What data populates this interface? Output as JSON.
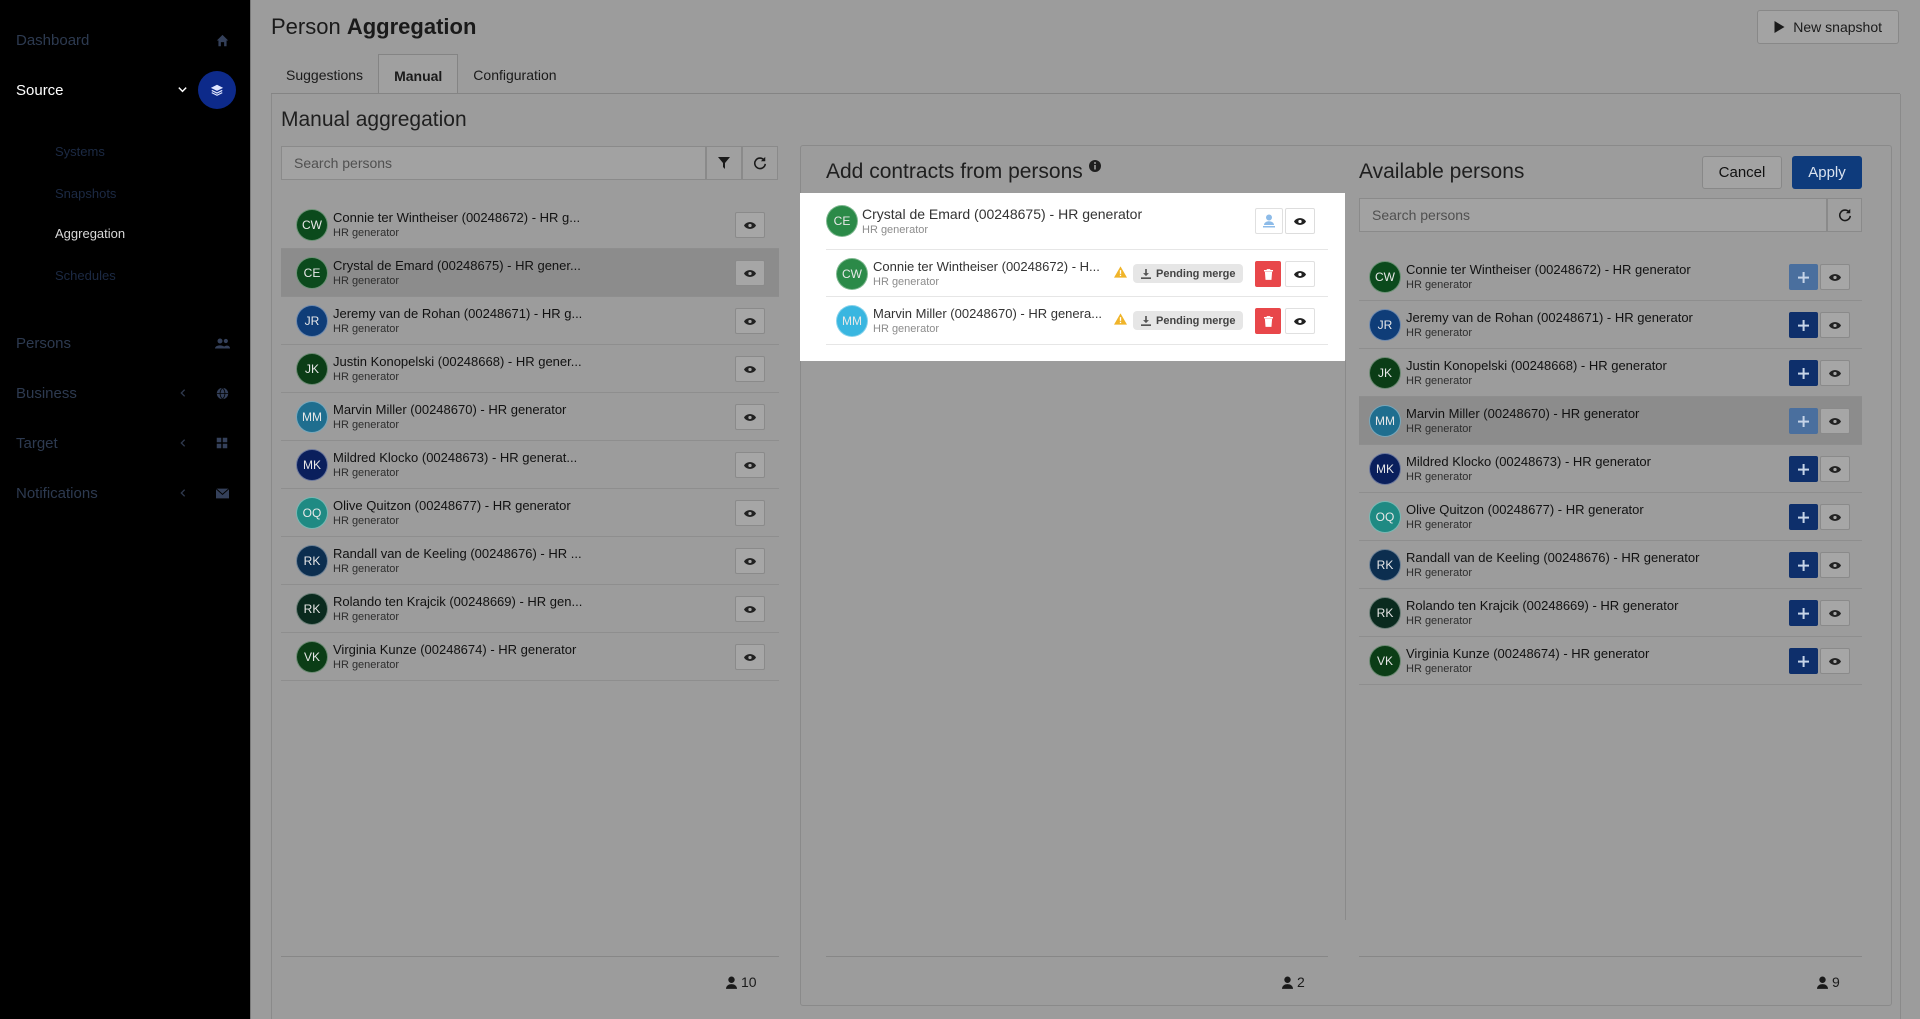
{
  "sidebar": {
    "items": [
      {
        "label": "Dashboard",
        "icon": "home-icon"
      },
      {
        "label": "Source",
        "icon": "layers-icon"
      },
      {
        "label": "Persons",
        "icon": "users-icon"
      },
      {
        "label": "Business",
        "icon": "globe-icon"
      },
      {
        "label": "Target",
        "icon": "grid-icon"
      },
      {
        "label": "Notifications",
        "icon": "envelope-icon"
      }
    ],
    "source_sub": [
      "Systems",
      "Snapshots",
      "Aggregation",
      "Schedules"
    ]
  },
  "header": {
    "title_light": "Person ",
    "title_bold": "Aggregation",
    "snapshot_label": "New snapshot"
  },
  "tabs": [
    "Suggestions",
    "Manual",
    "Configuration"
  ],
  "manual": {
    "title": "Manual aggregation",
    "search_placeholder": "Search persons",
    "persons": [
      {
        "initials": "CW",
        "name": "Connie ter Wintheiser (00248672) - HR g...",
        "sub": "HR generator",
        "color": "#0b4a1c"
      },
      {
        "initials": "CE",
        "name": "Crystal de Emard (00248675) - HR gener...",
        "sub": "HR generator",
        "color": "#0b4a1c"
      },
      {
        "initials": "JR",
        "name": "Jeremy van de Rohan (00248671) - HR g...",
        "sub": "HR generator",
        "color": "#0f3d78"
      },
      {
        "initials": "JK",
        "name": "Justin Konopelski (00248668) - HR gener...",
        "sub": "HR generator",
        "color": "#0b3d16"
      },
      {
        "initials": "MM",
        "name": "Marvin Miller (00248670) - HR generator",
        "sub": "HR generator",
        "color": "#1f6e8f"
      },
      {
        "initials": "MK",
        "name": "Mildred Klocko (00248673) - HR generat...",
        "sub": "HR generator",
        "color": "#0a1f5c"
      },
      {
        "initials": "OQ",
        "name": "Olive Quitzon (00248677) - HR generator",
        "sub": "HR generator",
        "color": "#1f8a83"
      },
      {
        "initials": "RK",
        "name": "Randall van de Keeling (00248676) - HR ...",
        "sub": "HR generator",
        "color": "#0c2e4f"
      },
      {
        "initials": "RK",
        "name": "Rolando ten Krajcik (00248669) - HR gen...",
        "sub": "HR generator",
        "color": "#0a2a1e"
      },
      {
        "initials": "VK",
        "name": "Virginia Kunze (00248674) - HR generator",
        "sub": "HR generator",
        "color": "#0b3d16"
      }
    ],
    "count": "10"
  },
  "contracts": {
    "title": "Add contracts from persons",
    "primary": {
      "initials": "CE",
      "name": "Crystal de Emard (00248675) - HR generator",
      "sub": "HR generator",
      "color": "#2b8a48"
    },
    "items": [
      {
        "initials": "CW",
        "name": "Connie ter Wintheiser (00248672) - H...",
        "sub": "HR generator",
        "color": "#2b8a48",
        "status": "Pending merge"
      },
      {
        "initials": "MM",
        "name": "Marvin Miller (00248670) - HR genera...",
        "sub": "HR generator",
        "color": "#39b6e0",
        "status": "Pending merge"
      }
    ],
    "count": "2"
  },
  "available": {
    "title": "Available persons",
    "search_placeholder": "Search persons",
    "cancel_label": "Cancel",
    "apply_label": "Apply",
    "persons": [
      {
        "initials": "CW",
        "name": "Connie ter Wintheiser (00248672) - HR generator",
        "sub": "HR generator",
        "color": "#0b4a1c"
      },
      {
        "initials": "JR",
        "name": "Jeremy van de Rohan (00248671) - HR generator",
        "sub": "HR generator",
        "color": "#0f3d78"
      },
      {
        "initials": "JK",
        "name": "Justin Konopelski (00248668) - HR generator",
        "sub": "HR generator",
        "color": "#0b3d16"
      },
      {
        "initials": "MM",
        "name": "Marvin Miller (00248670) - HR generator",
        "sub": "HR generator",
        "color": "#1f6e8f"
      },
      {
        "initials": "MK",
        "name": "Mildred Klocko (00248673) - HR generator",
        "sub": "HR generator",
        "color": "#0a1f5c"
      },
      {
        "initials": "OQ",
        "name": "Olive Quitzon (00248677) - HR generator",
        "sub": "HR generator",
        "color": "#1f8a83"
      },
      {
        "initials": "RK",
        "name": "Randall van de Keeling (00248676) - HR generator",
        "sub": "HR generator",
        "color": "#0c2e4f"
      },
      {
        "initials": "RK",
        "name": "Rolando ten Krajcik (00248669) - HR generator",
        "sub": "HR generator",
        "color": "#0a2a1e"
      },
      {
        "initials": "VK",
        "name": "Virginia Kunze (00248674) - HR generator",
        "sub": "HR generator",
        "color": "#0b3d16"
      }
    ],
    "count": "9"
  }
}
